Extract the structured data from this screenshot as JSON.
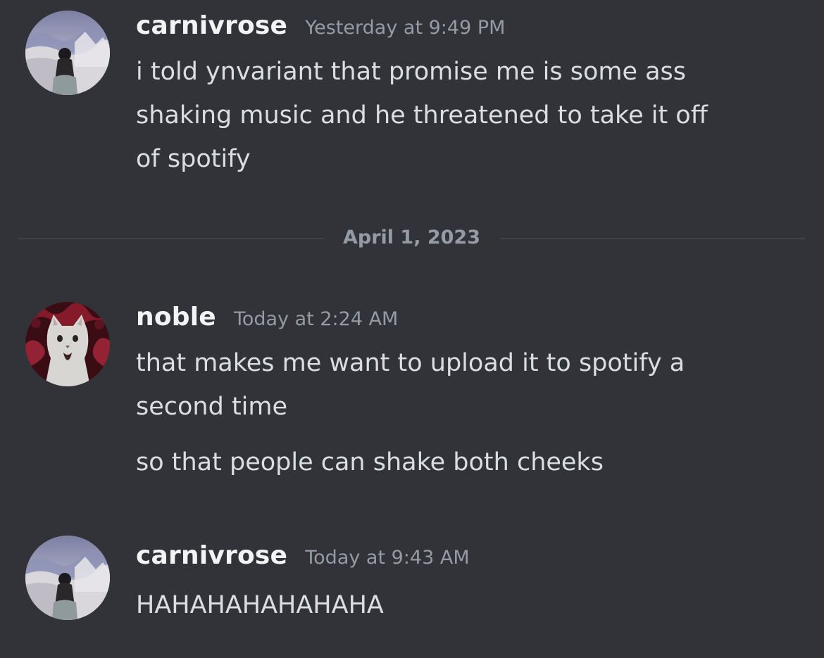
{
  "messages": [
    {
      "username": "carnivrose",
      "timestamp": "Yesterday at 9:49 PM",
      "lines": [
        "i told ynvariant that promise me is some ass",
        "shaking music and he threatened to take it off",
        "of spotify"
      ]
    },
    {
      "username": "noble",
      "timestamp": "Today at 2:24 AM",
      "lines": [
        "that makes me want to upload it to spotify a",
        "second time"
      ],
      "followup": "so that people can shake both cheeks"
    },
    {
      "username": "carnivrose",
      "timestamp": "Today at 9:43 AM",
      "lines": [
        "HAHAHAHAHAHAHA"
      ]
    }
  ],
  "divider": {
    "date": "April 1, 2023"
  },
  "colors": {
    "background": "#313338",
    "username": "#f2f3f5",
    "text": "#dbdee1",
    "muted": "#949ba4",
    "divider_line": "#3f4147"
  },
  "icons": {
    "carnivrose_avatar": "avatar-image-figure-in-snowy-landscape",
    "noble_avatar": "avatar-image-white-cat-on-red-pattern"
  }
}
